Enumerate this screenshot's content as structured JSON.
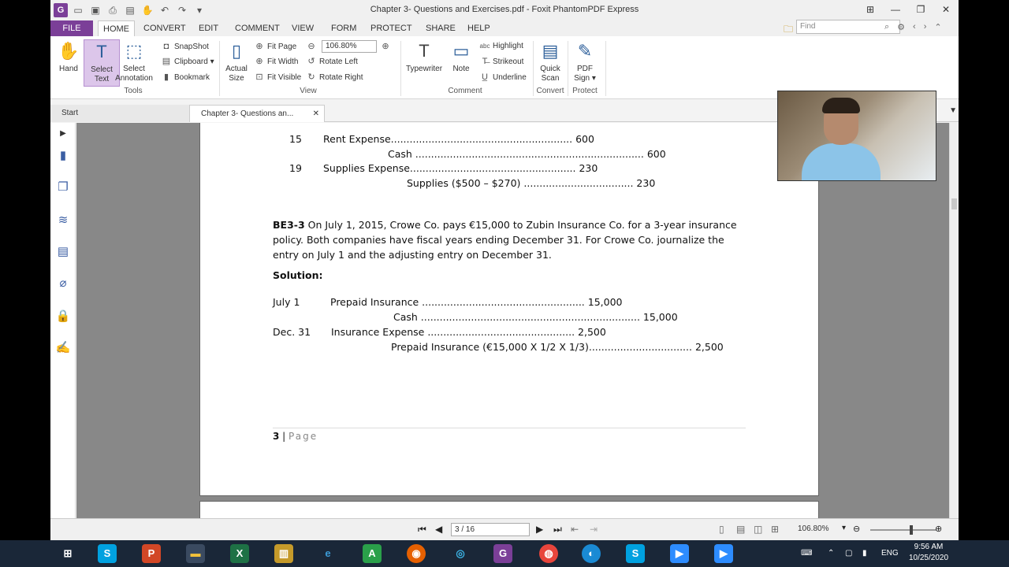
{
  "window": {
    "title": "Chapter 3- Questions and Exercises.pdf - Foxit PhantomPDF Express"
  },
  "menu": {
    "items": [
      "FILE",
      "HOME",
      "CONVERT",
      "EDIT",
      "COMMENT",
      "VIEW",
      "FORM",
      "PROTECT",
      "SHARE",
      "HELP"
    ],
    "active": "HOME",
    "find_placeholder": "Find"
  },
  "ribbon": {
    "hand": "Hand",
    "select_text_1": "Select",
    "select_text_2": "Text",
    "select_annotation_1": "Select",
    "select_annotation_2": "Annotation",
    "tools_label": "Tools",
    "snapshot": "SnapShot",
    "clipboard": "Clipboard",
    "bookmark": "Bookmark",
    "actual_size_1": "Actual",
    "actual_size_2": "Size",
    "fit_page": "Fit Page",
    "fit_width": "Fit Width",
    "fit_visible": "Fit Visible",
    "zoom_value": "106.80%",
    "rotate_left": "Rotate Left",
    "rotate_right": "Rotate Right",
    "view_label": "View",
    "typewriter": "Typewriter",
    "note": "Note",
    "highlight": "Highlight",
    "strikeout": "Strikeout",
    "underline": "Underline",
    "comment_label": "Comment",
    "quick_scan_1": "Quick",
    "quick_scan_2": "Scan",
    "convert_label": "Convert",
    "pdf_sign_1": "PDF",
    "pdf_sign_2": "Sign",
    "protect_label": "Protect"
  },
  "tabs": {
    "start": "Start",
    "document": "Chapter 3- Questions an..."
  },
  "document": {
    "l1_num": "15",
    "l1_text": "Rent Expense..........................................................  600",
    "l2_text": "Cash  .........................................................................  600",
    "l3_num": "19",
    "l3_text": "Supplies Expense.....................................................  230",
    "l4_text": "Supplies ($500 – $270)  ...................................  230",
    "be_label": "BE3-3",
    "be_line1": " On July 1, 2015, Crowe Co. pays €15,000 to Zubin Insurance Co. for a 3-year insurance",
    "be_line2": "policy. Both companies have fiscal years ending December 31. For Crowe Co. journalize the",
    "be_line3": "entry on July 1 and the adjusting entry on December 31.",
    "solution": "Solution:",
    "s1_date": "July 1",
    "s1_text": "Prepaid Insurance  ....................................................  15,000",
    "s2_text": "Cash  ......................................................................  15,000",
    "s3_date": "Dec. 31",
    "s3_text": "Insurance Expense  ...............................................  2,500",
    "s4_text": "Prepaid Insurance (€15,000 X 1/2 X 1/3).................................  2,500",
    "page_number": "3",
    "page_word": "Page"
  },
  "status": {
    "page_indicator": "3 / 16",
    "zoom": "106.80%"
  },
  "taskbar": {
    "time": "9:56 AM",
    "date": "10/25/2020",
    "language": "ENG"
  }
}
